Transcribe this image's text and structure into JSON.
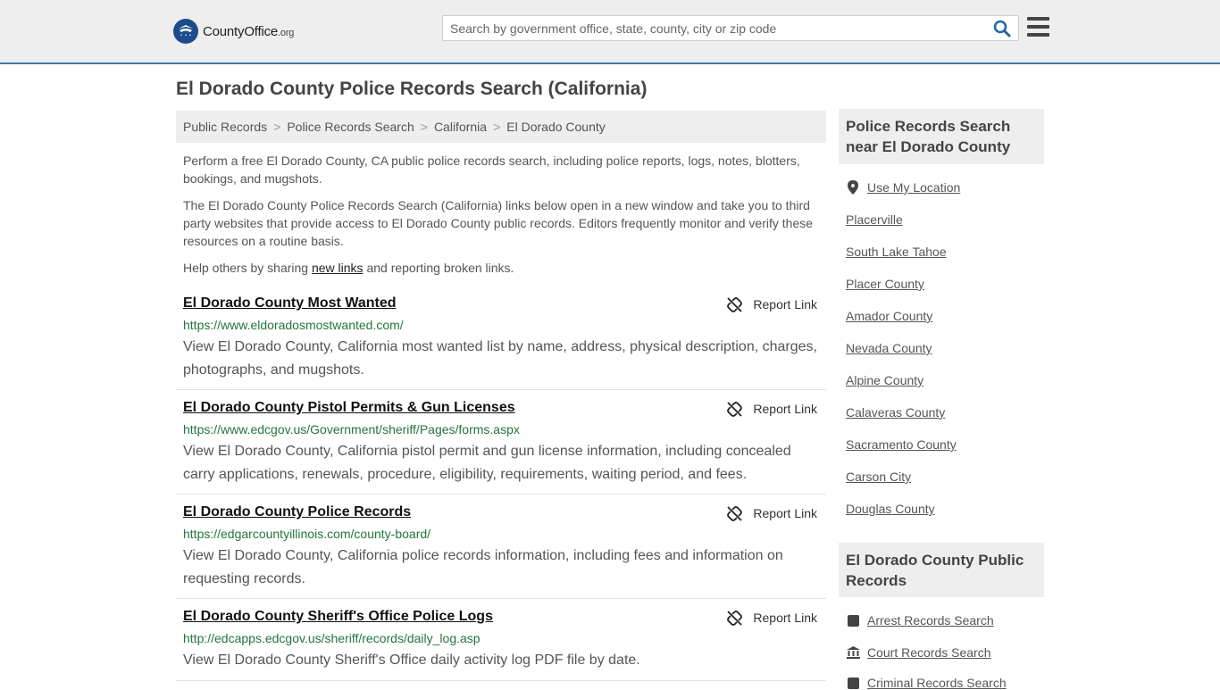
{
  "header": {
    "logo_name": "CountyOffice",
    "logo_tld": ".org",
    "search_placeholder": "Search by government office, state, county, city or zip code"
  },
  "page_title": "El Dorado County Police Records Search (California)",
  "breadcrumb": [
    "Public Records",
    "Police Records Search",
    "California",
    "El Dorado County"
  ],
  "intro": {
    "p1": "Perform a free El Dorado County, CA public police records search, including police reports, logs, notes, blotters, bookings, and mugshots.",
    "p2": "The El Dorado County Police Records Search (California) links below open in a new window and take you to third party websites that provide access to El Dorado County public records. Editors frequently monitor and verify these resources on a routine basis.",
    "p3_before": "Help others by sharing ",
    "p3_link": "new links",
    "p3_after": " and reporting broken links."
  },
  "report_label": "Report Link",
  "results": [
    {
      "title": "El Dorado County Most Wanted",
      "url": "https://www.eldoradosmostwanted.com/",
      "desc": "View El Dorado County, California most wanted list by name, address, physical description, charges, photographs, and mugshots."
    },
    {
      "title": "El Dorado County Pistol Permits & Gun Licenses",
      "url": "https://www.edcgov.us/Government/sheriff/Pages/forms.aspx",
      "desc": "View El Dorado County, California pistol permit and gun license information, including concealed carry applications, renewals, procedure, eligibility, requirements, waiting period, and fees."
    },
    {
      "title": "El Dorado County Police Records",
      "url": "https://edgarcountyillinois.com/county-board/",
      "desc": "View El Dorado County, California police records information, including fees and information on requesting records."
    },
    {
      "title": "El Dorado County Sheriff's Office Police Logs",
      "url": "http://edcapps.edcgov.us/sheriff/records/daily_log.asp",
      "desc": "View El Dorado County Sheriff's Office daily activity log PDF file by date."
    }
  ],
  "sidebar": {
    "nearby_heading": "Police Records Search near El Dorado County",
    "use_location": "Use My Location",
    "nearby": [
      "Placerville",
      "South Lake Tahoe",
      "Placer County",
      "Amador County",
      "Nevada County",
      "Alpine County",
      "Calaveras County",
      "Sacramento County",
      "Carson City",
      "Douglas County"
    ],
    "public_heading": "El Dorado County Public Records",
    "public_links": [
      "Arrest Records Search",
      "Court Records Search",
      "Criminal Records Search"
    ]
  },
  "colors": {
    "header_bg": "#eeeeee",
    "header_border": "#3f78b0",
    "url_green": "#22763d",
    "logo_blue": "#1c4c8c"
  }
}
